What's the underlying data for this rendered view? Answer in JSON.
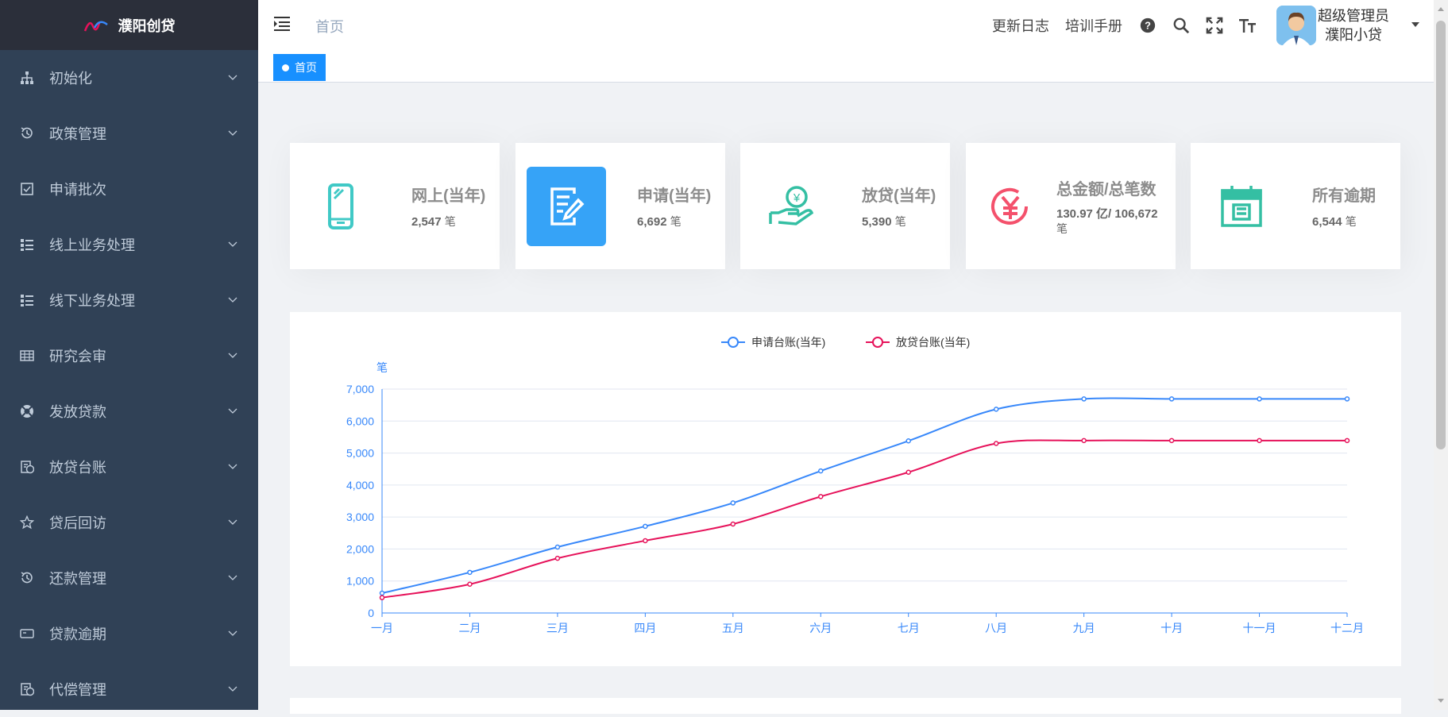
{
  "app": {
    "title": "濮阳创贷"
  },
  "sidebar": {
    "items": [
      {
        "label": "初始化",
        "icon": "tree-icon",
        "has_children": true
      },
      {
        "label": "政策管理",
        "icon": "history-icon",
        "has_children": true
      },
      {
        "label": "申请批次",
        "icon": "checkbox-icon",
        "has_children": false
      },
      {
        "label": "线上业务处理",
        "icon": "list-icon",
        "has_children": true
      },
      {
        "label": "线下业务处理",
        "icon": "list-icon",
        "has_children": true
      },
      {
        "label": "研究会审",
        "icon": "table-icon",
        "has_children": true
      },
      {
        "label": "发放贷款",
        "icon": "lifebuoy-icon",
        "has_children": true
      },
      {
        "label": "放贷台账",
        "icon": "money-doc-icon",
        "has_children": true
      },
      {
        "label": "贷后回访",
        "icon": "star-icon",
        "has_children": true
      },
      {
        "label": "还款管理",
        "icon": "history-icon",
        "has_children": true
      },
      {
        "label": "贷款逾期",
        "icon": "card-icon",
        "has_children": true
      },
      {
        "label": "代偿管理",
        "icon": "money-doc-icon",
        "has_children": true
      }
    ]
  },
  "header": {
    "breadcrumb": "首页",
    "links": [
      "更新日志",
      "培训手册"
    ],
    "icons": [
      "help-icon",
      "search-icon",
      "fullscreen-icon",
      "font-size-icon"
    ],
    "user": {
      "role": "超级管理员",
      "org": "濮阳小贷"
    }
  },
  "tags": {
    "active": "首页"
  },
  "cards": [
    {
      "title": "网上(当年)",
      "value": "2,547",
      "unit": "笔",
      "icon": "mobile-icon",
      "color": "#40c9c6",
      "active": false
    },
    {
      "title": "申请(当年)",
      "value": "6,692",
      "unit": "笔",
      "icon": "edit-doc-icon",
      "color": "#36a3f7",
      "active": true
    },
    {
      "title": "放贷(当年)",
      "value": "5,390",
      "unit": "笔",
      "icon": "money-hand-icon",
      "color": "#34bfa3",
      "active": false
    },
    {
      "title": "总金额/总笔数",
      "value": "130.97 亿/ 106,672",
      "unit": "笔",
      "icon": "yuan-icon",
      "color": "#f4516c",
      "active": false
    },
    {
      "title": "所有逾期",
      "value": "6,544",
      "unit": "笔",
      "icon": "calendar-overdue-icon",
      "color": "#34bfa3",
      "active": false
    }
  ],
  "colors": {
    "sidebar_bg": "#304156",
    "logo_bg": "#2b2f3a",
    "accent": "#1890ff",
    "series_blue": "#3888fa",
    "series_red": "#e6125a"
  },
  "chart_data": {
    "type": "line",
    "ylabel": "笔",
    "ylim": [
      0,
      7000
    ],
    "yticks": [
      "0",
      "1,000",
      "2,000",
      "3,000",
      "4,000",
      "5,000",
      "6,000",
      "7,000"
    ],
    "categories": [
      "一月",
      "二月",
      "三月",
      "四月",
      "五月",
      "六月",
      "七月",
      "八月",
      "九月",
      "十月",
      "十一月",
      "十二月"
    ],
    "legend_position": "top-center",
    "grid": true,
    "series": [
      {
        "name": "申请台账(当年)",
        "color": "#3888fa",
        "values": [
          620,
          1270,
          2060,
          2710,
          3440,
          4440,
          5380,
          6370,
          6692,
          6692,
          6692,
          6692
        ]
      },
      {
        "name": "放贷台账(当年)",
        "color": "#e6125a",
        "values": [
          480,
          900,
          1710,
          2260,
          2780,
          3640,
          4400,
          5300,
          5390,
          5390,
          5390,
          5390
        ]
      }
    ]
  }
}
